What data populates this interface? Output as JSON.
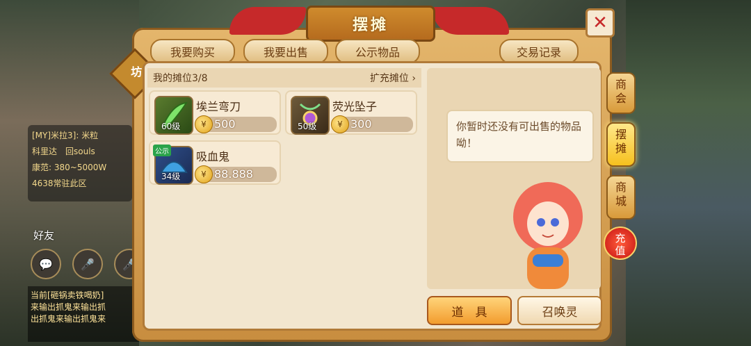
{
  "window": {
    "title": "摆摊",
    "close_label": "✕"
  },
  "tabs": [
    {
      "label": "我要购买"
    },
    {
      "label": "我要出售"
    },
    {
      "label": "公示物品"
    }
  ],
  "trade_record_label": "交易记录",
  "badge": "坊",
  "stall": {
    "title": "我的摊位3/8",
    "expand_label": "扩充摊位 ›"
  },
  "items": [
    {
      "name": "埃兰弯刀",
      "level": "60级",
      "price": "500",
      "tag": ""
    },
    {
      "name": "荧光坠子",
      "level": "50级",
      "price": "300",
      "tag": ""
    },
    {
      "name": "吸血鬼",
      "level": "34级",
      "price": "88.888",
      "tag": "公示"
    }
  ],
  "empty_message": "你暂时还没有可出售的物品呦！",
  "buttons": {
    "items": "道　具",
    "summon": "召唤灵"
  },
  "side_nav": {
    "guild": "商\n会",
    "stall": "摆\n摊",
    "mall": "商\n城",
    "recharge": "充\n值"
  },
  "background": {
    "chat": [
      "[MY]米拉3]: 米粒",
      "科里达　回souls",
      "康范: 380~5000W",
      "4638常驻此区"
    ],
    "friend_label": "好友",
    "bottom_chat": [
      "当前[砸锅卖铁喝奶]",
      "来输出抓鬼来输出抓",
      "出抓鬼来输出抓鬼来"
    ],
    "icons": [
      "chat-icon",
      "voice-icon",
      "voice-icon"
    ]
  },
  "colors": {
    "accent": "#c6292a",
    "frame": "#c88d3f",
    "panel": "#f2e6cf"
  }
}
